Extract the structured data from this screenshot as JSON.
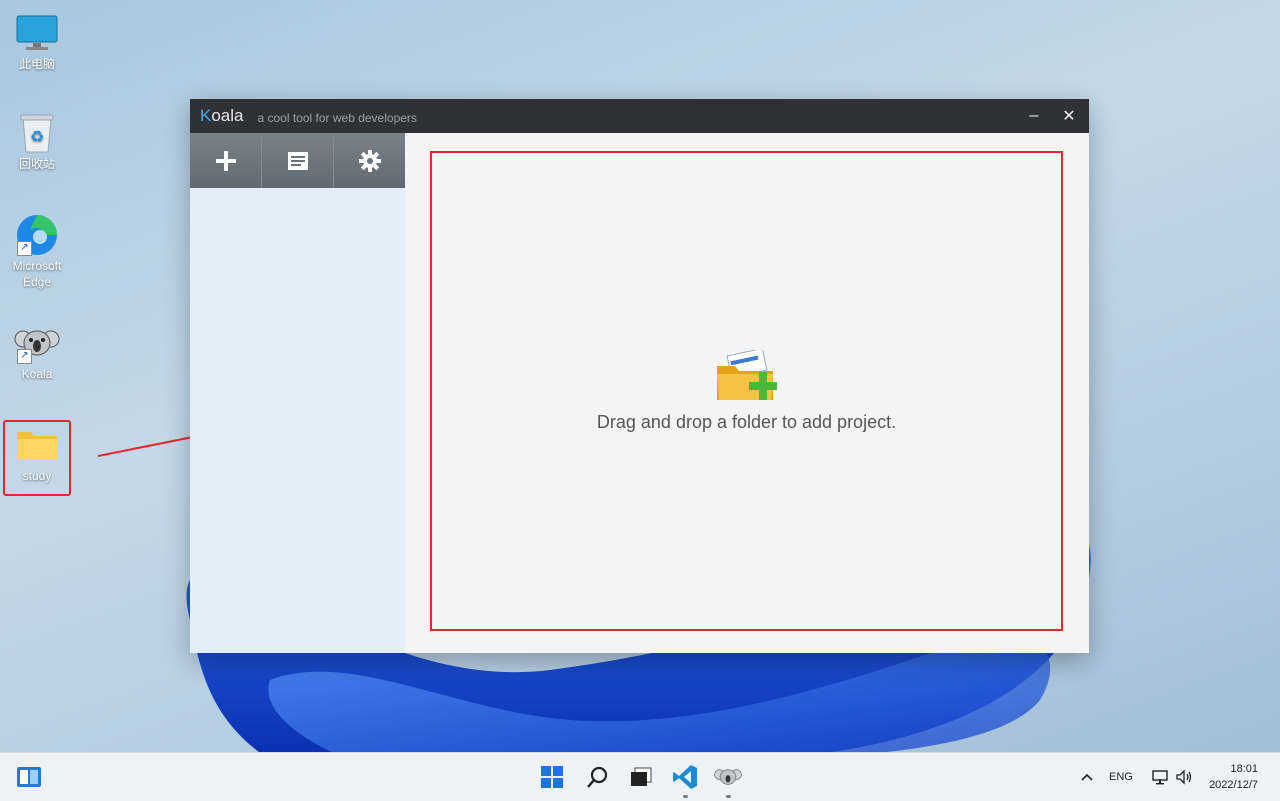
{
  "desktop": {
    "icons": [
      {
        "label": "此电脑",
        "icon": "this-pc-icon"
      },
      {
        "label": "回收站",
        "icon": "recycle-bin-icon"
      },
      {
        "label_line1": "Microsoft",
        "label_line2": "Edge",
        "icon": "edge-icon"
      },
      {
        "label": "Koala",
        "icon": "koala-icon"
      },
      {
        "label": "study",
        "icon": "folder-icon"
      }
    ]
  },
  "koala_window": {
    "title": "oala",
    "title_first_letter": "K",
    "tagline": "a cool tool for web developers",
    "minimize_label": "–",
    "close_label": "✕",
    "toolbar": [
      {
        "icon": "plus-icon"
      },
      {
        "icon": "document-icon"
      },
      {
        "icon": "gear-icon"
      }
    ],
    "dropzone_text": "Drag and drop a folder to add project."
  },
  "taskbar": {
    "tray_lang": "ENG",
    "clock_time": "18:01",
    "clock_date": "2022/12/7"
  },
  "colors": {
    "highlight_red": "#e8272b",
    "titlebar": "#2f3136",
    "accent_blue": "#3fa9f5"
  }
}
